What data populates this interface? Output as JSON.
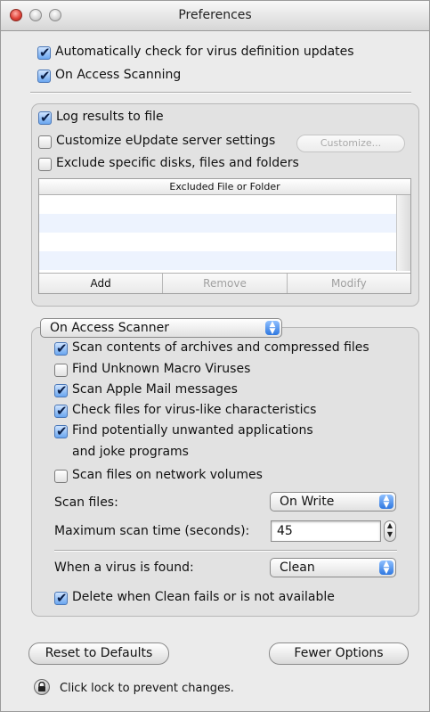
{
  "window": {
    "title": "Preferences"
  },
  "general": {
    "auto_update": {
      "label": "Automatically check for virus definition updates",
      "checked": true
    },
    "on_access": {
      "label": "On Access Scanning",
      "checked": true
    }
  },
  "logging": {
    "log_results": {
      "label": "Log results to file",
      "checked": true
    },
    "custom_eupdate": {
      "label": "Customize eUpdate server settings",
      "checked": false
    },
    "customize_button": "Customize...",
    "exclude": {
      "label": "Exclude specific disks, files and folders",
      "checked": false
    },
    "table": {
      "header": "Excluded File or Folder",
      "rows": [],
      "buttons": {
        "add": "Add",
        "remove": "Remove",
        "modify": "Modify"
      }
    }
  },
  "scanner": {
    "mode_popup": "On Access Scanner",
    "options": [
      {
        "label": "Scan contents of archives and compressed files",
        "checked": true
      },
      {
        "label": "Find Unknown Macro Viruses",
        "checked": false
      },
      {
        "label": "Scan Apple Mail messages",
        "checked": true
      },
      {
        "label": "Check files for virus-like characteristics",
        "checked": true
      },
      {
        "label": "Find potentially unwanted applications",
        "label2": "and joke programs",
        "checked": true
      },
      {
        "label": "Scan files on network volumes",
        "checked": false
      }
    ],
    "scan_files_label": "Scan files:",
    "scan_files_value": "On Write",
    "max_time_label": "Maximum scan time (seconds):",
    "max_time_value": "45",
    "virus_found_label": "When a virus is found:",
    "virus_found_value": "Clean",
    "delete_option": {
      "label": "Delete when Clean fails or is not available",
      "checked": true
    }
  },
  "footer": {
    "reset_button": "Reset to Defaults",
    "fewer_button": "Fewer Options",
    "lock_text": "Click lock to prevent changes."
  }
}
